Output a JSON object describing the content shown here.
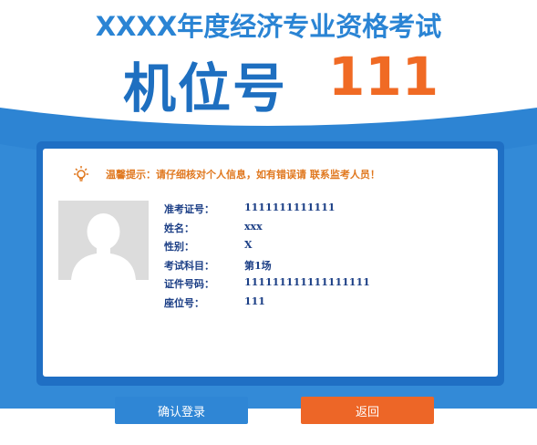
{
  "header": {
    "exam_title": "XXXX年度经济专业资格考试",
    "seat_label": "机位号",
    "seat_number": "111"
  },
  "tip": {
    "icon": "lightbulb-icon",
    "text": "温馨提示：请仔细核对个人信息，如有错误请 联系监考人员！"
  },
  "candidate": {
    "photo_icon": "person-silhouette-icon",
    "fields": [
      {
        "label": "准考证号：",
        "value": "1111111111111"
      },
      {
        "label": "姓名：",
        "value": "xxx"
      },
      {
        "label": "性别：",
        "value": "X"
      },
      {
        "label": "考试科目：",
        "value": "第1场"
      },
      {
        "label": "证件号码：",
        "value": "111111111111111111"
      },
      {
        "label": "座位号：",
        "value": "111"
      }
    ]
  },
  "buttons": {
    "confirm_label": "确认登录",
    "back_label": "返回"
  },
  "colors": {
    "title_blue": "#2a84d4",
    "seat_label_blue": "#1e6fc0",
    "seat_number_orange": "#f06a24",
    "panel_blue": "#1f6fc4",
    "tip_orange": "#e0781f",
    "field_text": "#1c3f86",
    "confirm_button": "#2f86d5",
    "back_button": "#ed6627"
  }
}
